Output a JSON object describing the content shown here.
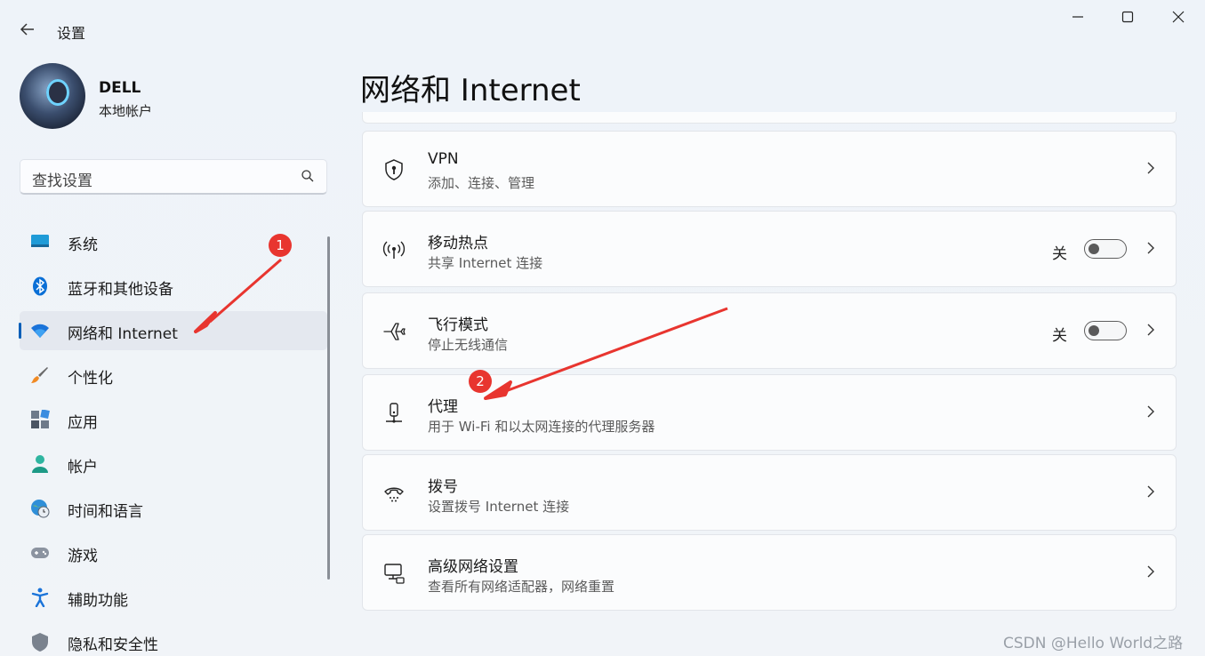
{
  "app": {
    "title": "设置",
    "back_icon": "back-arrow-icon",
    "window_controls": [
      "minimize-icon",
      "maximize-icon",
      "close-icon"
    ]
  },
  "profile": {
    "name": "DELL",
    "account_type": "本地帐户"
  },
  "search": {
    "placeholder": "查找设置",
    "icon": "search-icon"
  },
  "sidebar": {
    "items": [
      {
        "label": "系统",
        "icon": "monitor-icon",
        "active": false
      },
      {
        "label": "蓝牙和其他设备",
        "icon": "bluetooth-icon",
        "active": false
      },
      {
        "label": "网络和 Internet",
        "icon": "wifi-icon",
        "active": true
      },
      {
        "label": "个性化",
        "icon": "paintbrush-icon",
        "active": false
      },
      {
        "label": "应用",
        "icon": "apps-icon",
        "active": false
      },
      {
        "label": "帐户",
        "icon": "person-icon",
        "active": false
      },
      {
        "label": "时间和语言",
        "icon": "globe-clock-icon",
        "active": false
      },
      {
        "label": "游戏",
        "icon": "gamepad-icon",
        "active": false
      },
      {
        "label": "辅助功能",
        "icon": "accessibility-icon",
        "active": false
      },
      {
        "label": "隐私和安全性",
        "icon": "shield-icon",
        "active": false
      }
    ]
  },
  "main": {
    "title": "网络和 Internet",
    "cards": [
      {
        "title": "VPN",
        "subtitle": "添加、连接、管理",
        "icon": "vpn-shield-icon"
      },
      {
        "title": "移动热点",
        "subtitle": "共享 Internet 连接",
        "icon": "hotspot-icon",
        "toggle_state": "关",
        "toggle_on": false
      },
      {
        "title": "飞行模式",
        "subtitle": "停止无线通信",
        "icon": "airplane-icon",
        "toggle_state": "关",
        "toggle_on": false
      },
      {
        "title": "代理",
        "subtitle": "用于 Wi-Fi 和以太网连接的代理服务器",
        "icon": "proxy-icon"
      },
      {
        "title": "拨号",
        "subtitle": "设置拨号 Internet 连接",
        "icon": "dialup-icon"
      },
      {
        "title": "高级网络设置",
        "subtitle": "查看所有网络适配器，网络重置",
        "icon": "network-pc-icon"
      }
    ]
  },
  "annotations": {
    "badge1": "1",
    "badge2": "2",
    "color": "#e8352f"
  },
  "watermark": "CSDN @Hello World之路"
}
